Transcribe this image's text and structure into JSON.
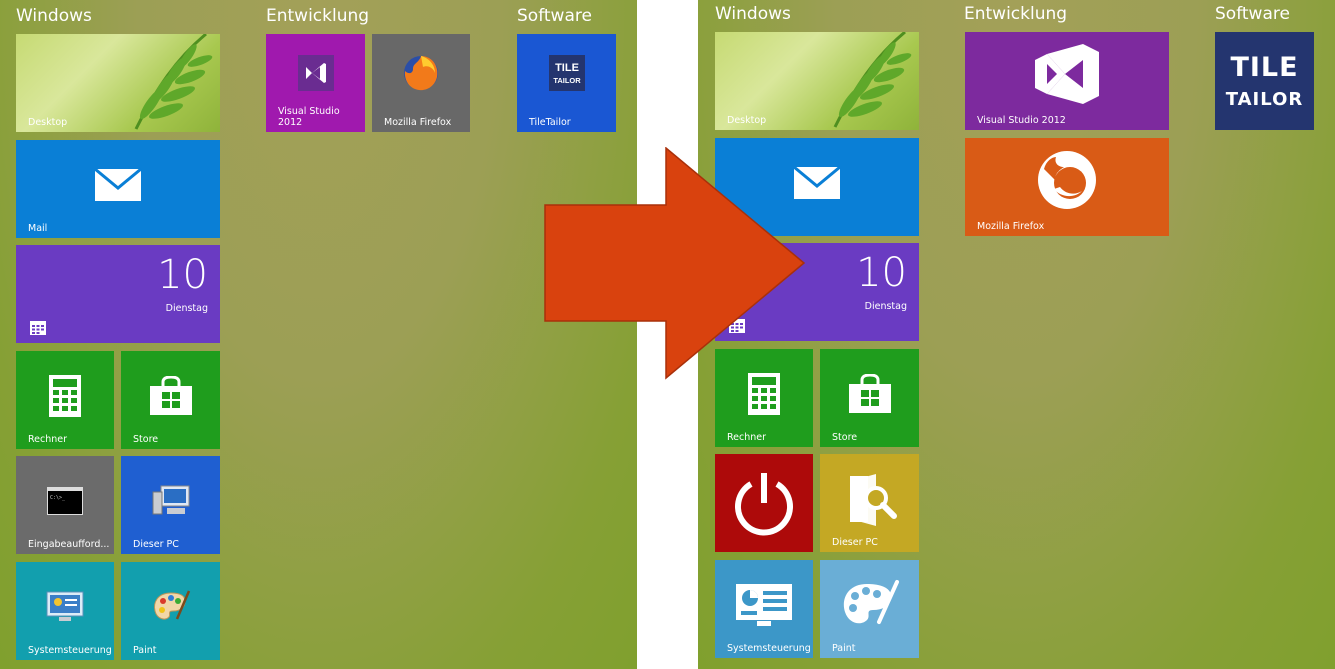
{
  "left": {
    "groups": {
      "windows": "Windows",
      "entwicklung": "Entwicklung",
      "software": "Software"
    },
    "tiles": {
      "desktop": "Desktop",
      "mail": "Mail",
      "calendar_num": "10",
      "calendar_day": "Dienstag",
      "rechner": "Rechner",
      "store": "Store",
      "eingabe": "Eingabeaufford...",
      "dieser_pc": "Dieser PC",
      "systemsteuerung": "Systemsteuerung",
      "paint": "Paint",
      "visual_studio": "Visual Studio\n2012",
      "firefox": "Mozilla Firefox",
      "tiletailor": "TileTailor"
    }
  },
  "right": {
    "groups": {
      "windows": "Windows",
      "entwicklung": "Entwicklung",
      "software": "Software"
    },
    "tiles": {
      "desktop": "Desktop",
      "calendar_num": "10",
      "calendar_day": "Dienstag",
      "rechner": "Rechner",
      "store": "Store",
      "dieser_pc": "Dieser PC",
      "systemsteuerung": "Systemsteuerung",
      "paint": "Paint",
      "visual_studio": "Visual Studio 2012",
      "firefox": "Mozilla Firefox",
      "tile_logo_line1": "TILE",
      "tile_logo_line2": "TAILOR"
    }
  },
  "colors": {
    "purple": "#6a3bc2",
    "blue": "#0a7fd6",
    "green": "#1f9d1d",
    "gray": "#6b6b6b",
    "darkblue": "#1f5fd1",
    "teal": "#129fae",
    "vs_purple": "#a019ae",
    "ff_gray": "#686868",
    "tt_blue": "#1a57d3",
    "red": "#ad0a0a",
    "mustard": "#c4a824",
    "steelblue": "#3c97c8",
    "vs_purple2": "#7d2a9e",
    "orange": "#d95b16",
    "navy": "#24356f",
    "arrow": "#d9420e"
  }
}
